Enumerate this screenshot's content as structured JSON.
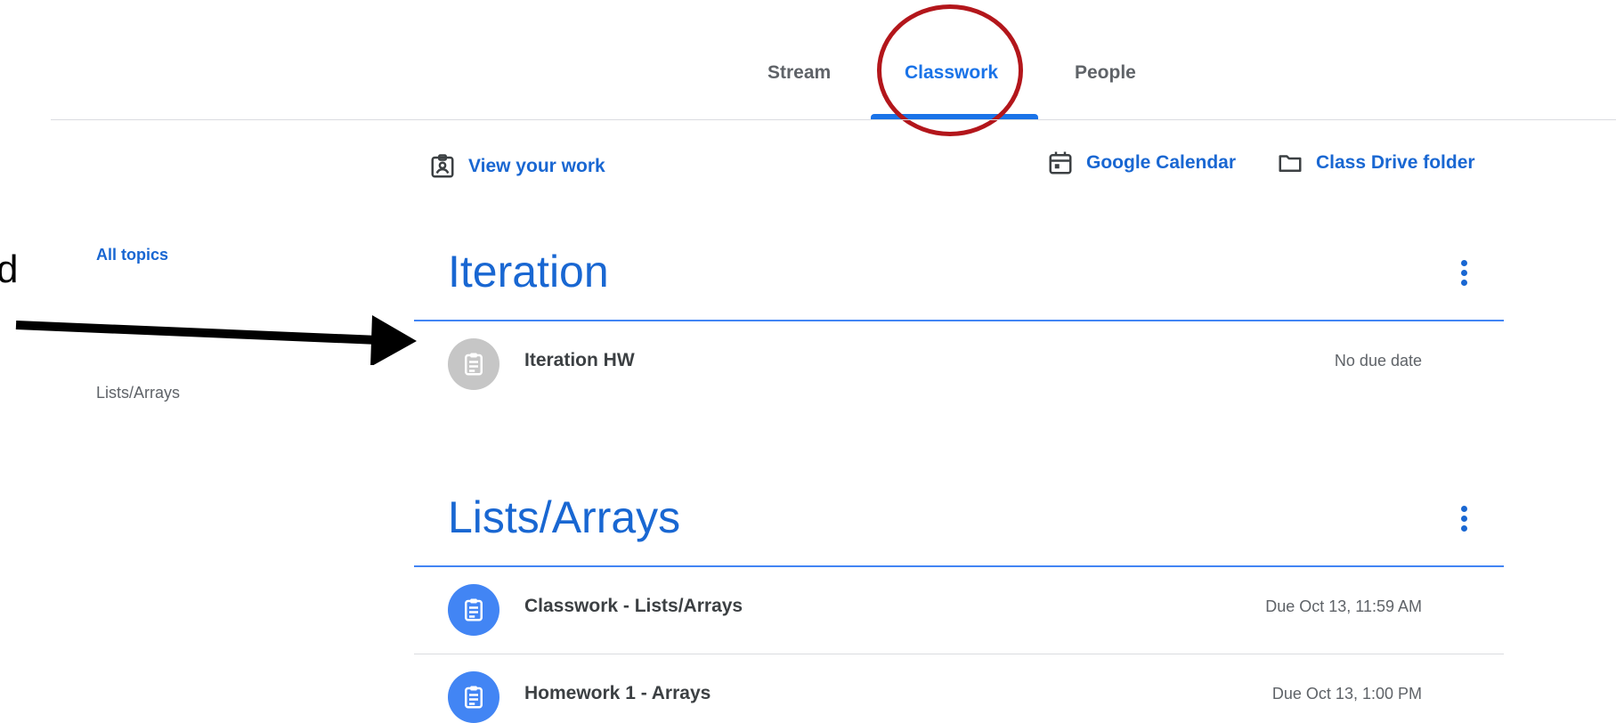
{
  "tabs": {
    "stream": "Stream",
    "classwork": "Classwork",
    "people": "People",
    "active": "Classwork"
  },
  "toolbar": {
    "view_work": "View your work",
    "calendar": "Google Calendar",
    "drive": "Class Drive folder"
  },
  "sidebar": {
    "items": [
      {
        "label": "All topics",
        "active": true
      },
      {
        "label": "Lists/Arrays",
        "active": false
      }
    ]
  },
  "annotation": {
    "edge_text": "d"
  },
  "topics": [
    {
      "title": "Iteration",
      "items": [
        {
          "title": "Iteration HW",
          "due": "No due date",
          "icon_color": "gray"
        }
      ]
    },
    {
      "title": "Lists/Arrays",
      "items": [
        {
          "title": "Classwork - Lists/Arrays",
          "due": "Due Oct 13, 11:59 AM",
          "icon_color": "blue"
        },
        {
          "title": "Homework 1 - Arrays",
          "due": "Due Oct 13, 1:00 PM",
          "icon_color": "blue"
        }
      ]
    }
  ],
  "colors": {
    "accent": "#1967d2",
    "topic_rule": "#4285f4",
    "annotation_circle": "#b3161b",
    "icon_gray": "#c6c6c6",
    "icon_blue": "#4285f4"
  }
}
